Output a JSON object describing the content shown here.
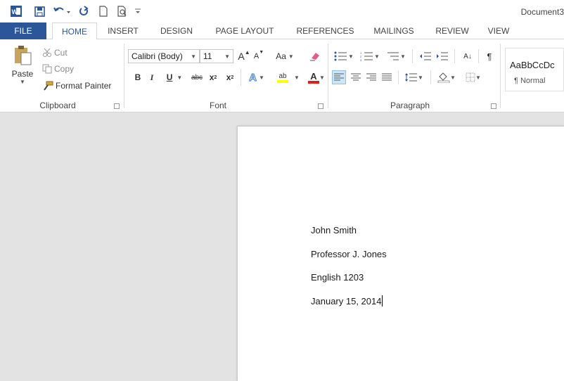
{
  "window": {
    "title": "Document3"
  },
  "tabs": [
    "FILE",
    "HOME",
    "INSERT",
    "DESIGN",
    "PAGE LAYOUT",
    "REFERENCES",
    "MAILINGS",
    "REVIEW",
    "VIEW"
  ],
  "clipboard": {
    "paste_label": "Paste",
    "cut_label": "Cut",
    "copy_label": "Copy",
    "format_painter_label": "Format Painter",
    "group_label": "Clipboard"
  },
  "font": {
    "font_name": "Calibri (Body)",
    "font_size": "11",
    "grow_glyph": "A",
    "shrink_glyph": "A",
    "change_case_glyph": "Aa",
    "bold_glyph": "B",
    "italic_glyph": "I",
    "underline_glyph": "U",
    "strike_glyph": "abc",
    "subscript_glyph": "x",
    "subscript_sub": "2",
    "superscript_glyph": "x",
    "superscript_sup": "2",
    "highlight_glyph": "ab",
    "color_glyph": "A",
    "effects_glyph": "A",
    "group_label": "Font",
    "highlight_color": "#ffff00",
    "font_color": "#e01e1e"
  },
  "paragraph": {
    "group_label": "Paragraph",
    "sort_glyph": "A↓",
    "pilcrow_glyph": "¶"
  },
  "styles": {
    "sample": "AaBbCcDc",
    "name": "¶ Normal"
  },
  "document": {
    "lines": [
      "John Smith",
      "Professor J. Jones",
      "English 1203",
      "January 15, 2014"
    ]
  },
  "colors": {
    "accent": "#2b579a",
    "workspace": "#e3e3e3"
  }
}
